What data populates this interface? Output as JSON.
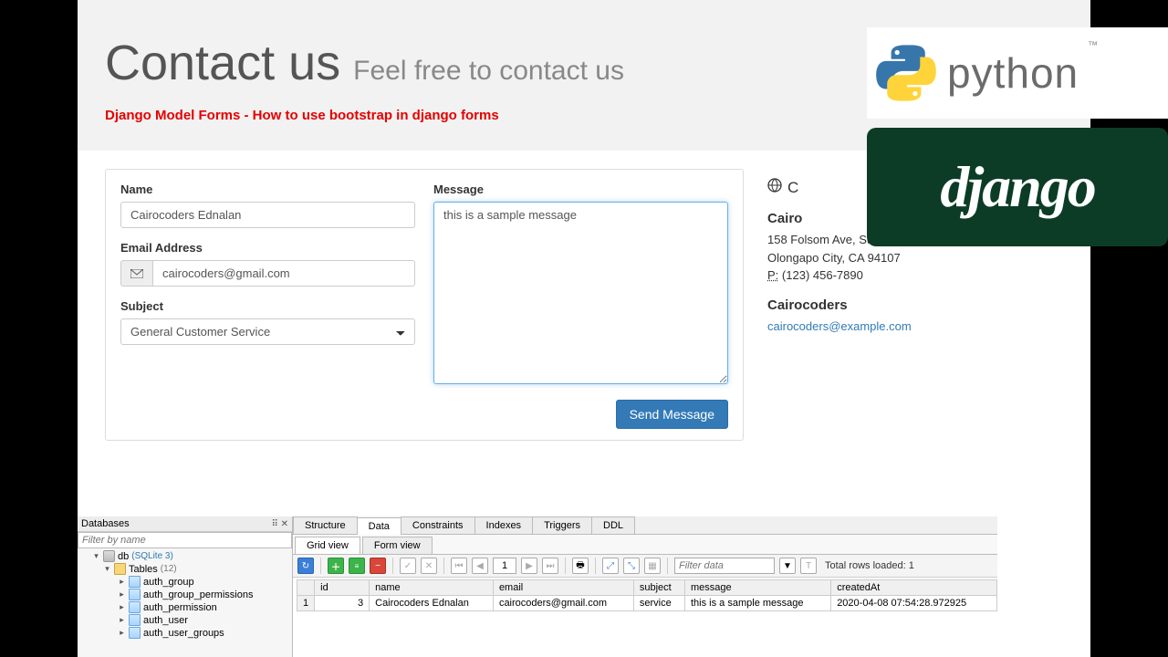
{
  "header": {
    "title_main": "Contact us",
    "title_sub": "Feel free to contact us",
    "tagline": "Django Model Forms - How to use bootstrap in django forms"
  },
  "form": {
    "name_label": "Name",
    "name_value": "Cairocoders Ednalan",
    "email_label": "Email Address",
    "email_value": "cairocoders@gmail.com",
    "subject_label": "Subject",
    "subject_value": "General Customer Service",
    "message_label": "Message",
    "message_value": "this is a sample message",
    "submit_label": "Send Message"
  },
  "sidebar": {
    "office_hours_label": "C",
    "name": "Cairo",
    "addr1": "158 Folsom Ave, Suite 600",
    "addr2": "Olongapo City, CA 94107",
    "phone_label": "P:",
    "phone": "(123) 456-7890",
    "contact_name": "Cairocoders",
    "contact_email": "cairocoders@example.com"
  },
  "logos": {
    "python_text": "python",
    "python_tm": "™",
    "django_text": "django"
  },
  "db": {
    "panel_title": "Databases",
    "filter_placeholder": "Filter by name",
    "tree": {
      "db_name": "db",
      "db_type": "(SQLite 3)",
      "tables_label": "Tables",
      "tables_count": "(12)",
      "tables": [
        "auth_group",
        "auth_group_permissions",
        "auth_permission",
        "auth_user",
        "auth_user_groups"
      ]
    },
    "top_tabs": [
      "Structure",
      "Data",
      "Constraints",
      "Indexes",
      "Triggers",
      "DDL"
    ],
    "active_top_tab": 1,
    "sub_tabs": [
      "Grid view",
      "Form view"
    ],
    "active_sub_tab": 0,
    "page_value": "1",
    "filter_data_placeholder": "Filter data",
    "totals_label": "Total rows loaded: 1",
    "columns": [
      "id",
      "name",
      "email",
      "subject",
      "message",
      "createdAt"
    ],
    "rows": [
      {
        "rownum": "1",
        "id": "3",
        "name": "Cairocoders Ednalan",
        "email": "cairocoders@gmail.com",
        "subject": "service",
        "message": "this is a sample message",
        "createdAt": "2020-04-08 07:54:28.972925"
      }
    ]
  }
}
